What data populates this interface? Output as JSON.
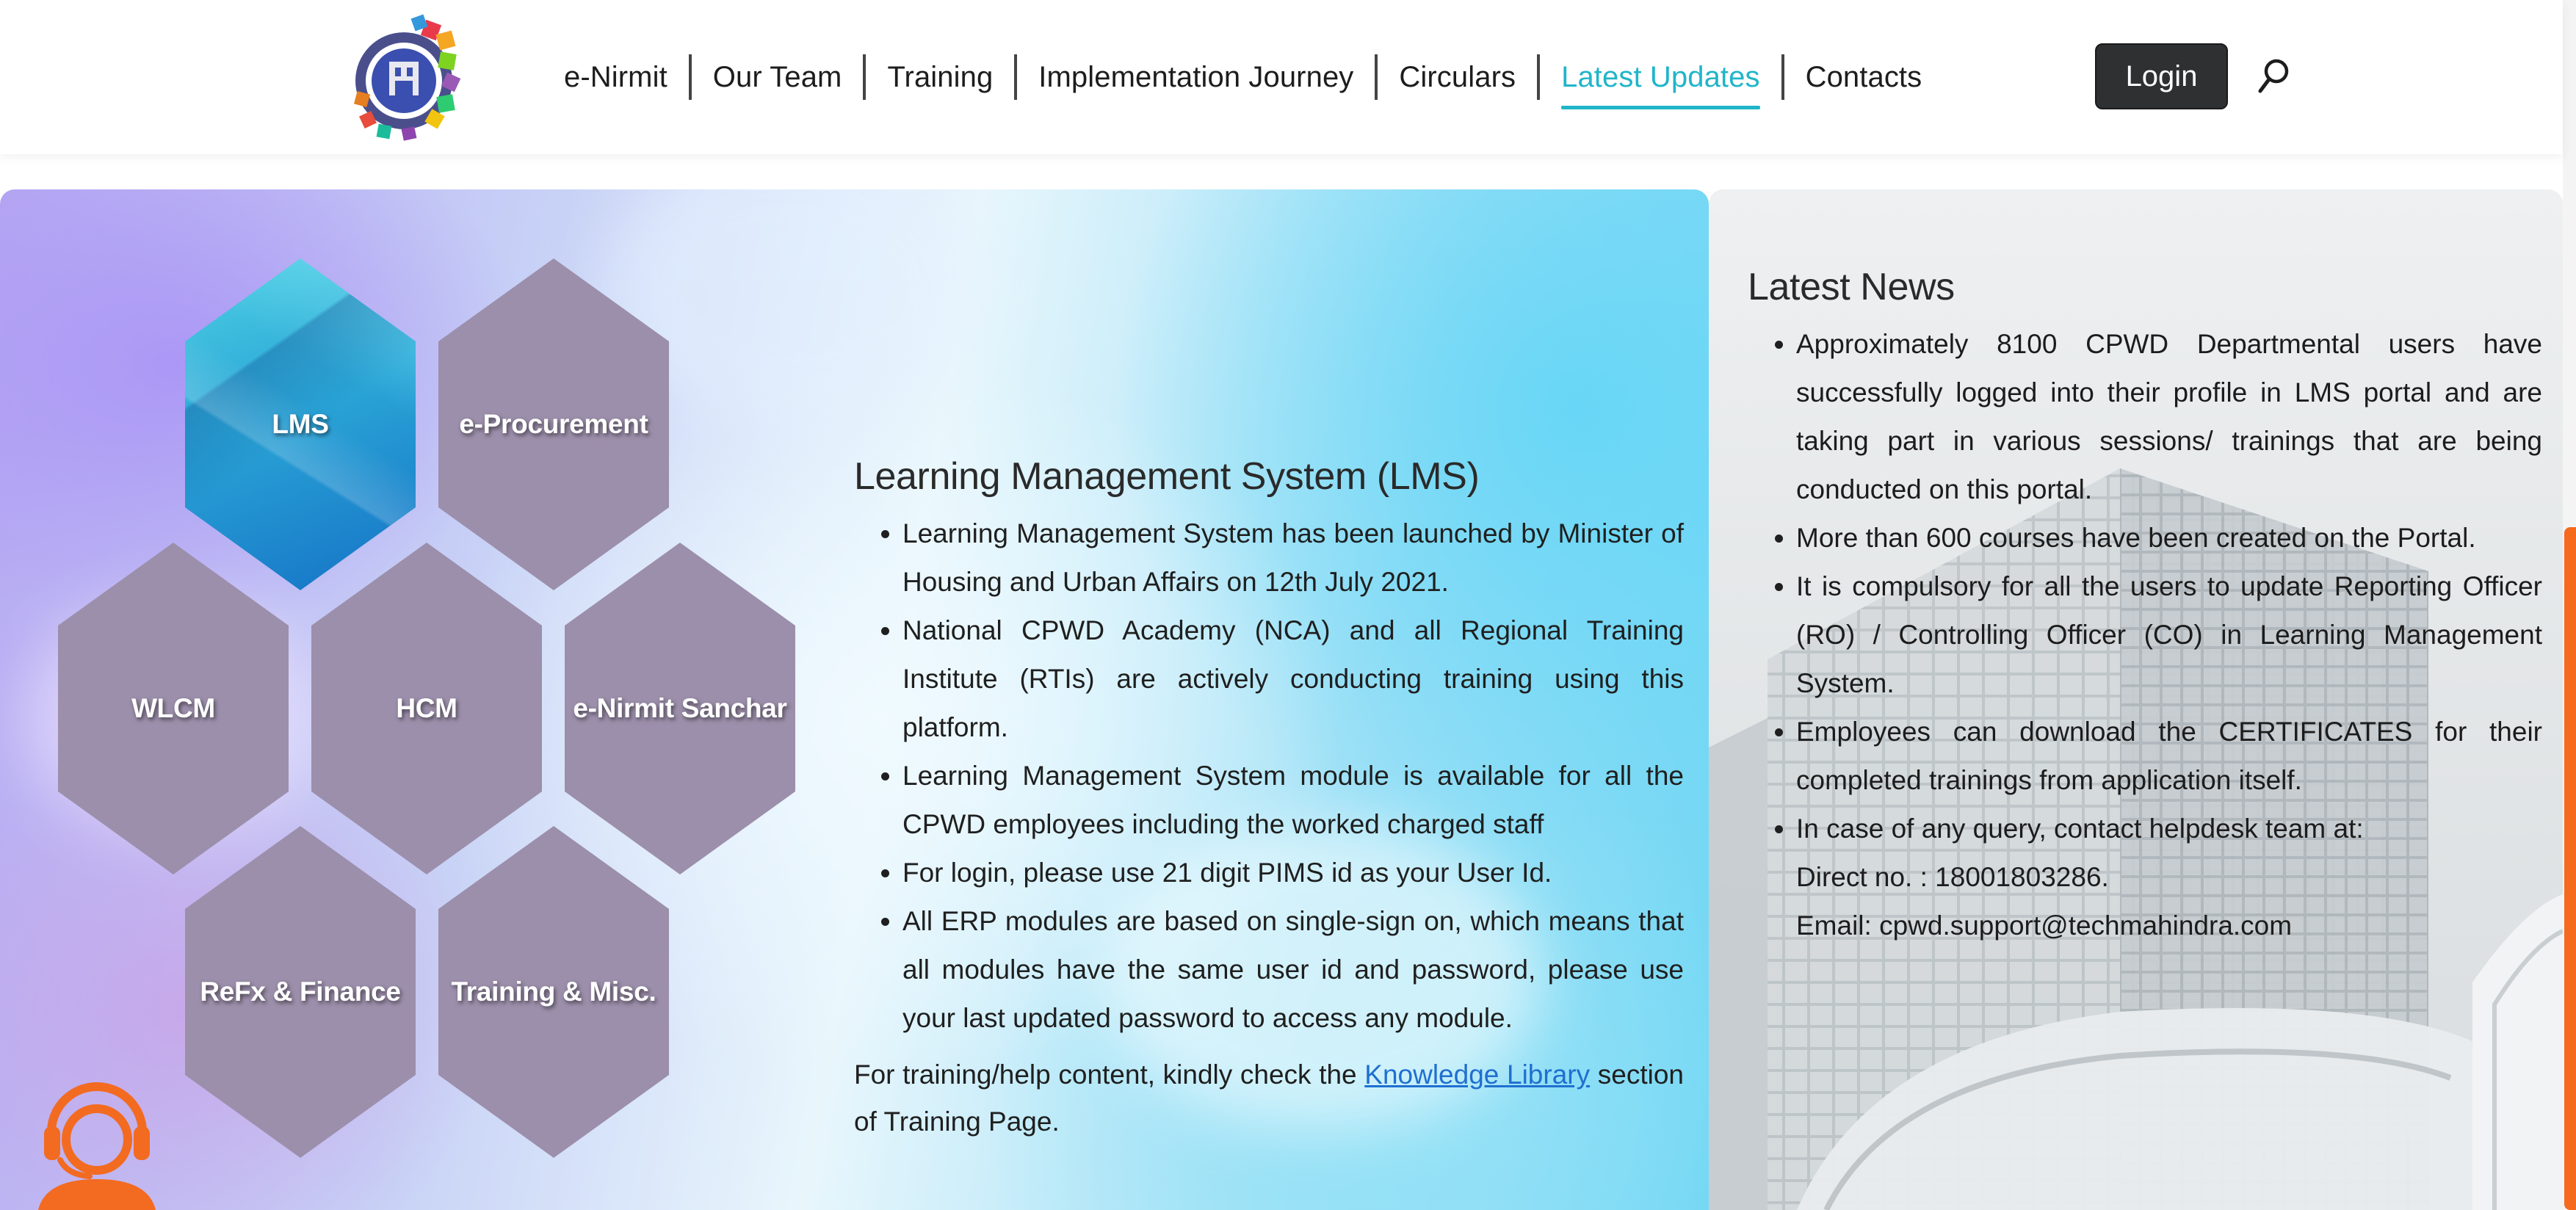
{
  "header": {
    "nav": [
      {
        "label": "e-Nirmit",
        "active": false
      },
      {
        "label": "Our Team",
        "active": false
      },
      {
        "label": "Training",
        "active": false
      },
      {
        "label": "Implementation Journey",
        "active": false
      },
      {
        "label": "Circulars",
        "active": false
      },
      {
        "label": "Latest Updates",
        "active": true
      },
      {
        "label": "Contacts",
        "active": false
      }
    ],
    "login_label": "Login",
    "accent_color": "#20b5c9"
  },
  "modules": [
    {
      "label": "LMS",
      "selected": true
    },
    {
      "label": "e-Procurement",
      "selected": false
    },
    {
      "label": "WLCM",
      "selected": false
    },
    {
      "label": "HCM",
      "selected": false
    },
    {
      "label": "e-Nirmit Sanchar",
      "selected": false
    },
    {
      "label": "ReFx & Finance",
      "selected": false
    },
    {
      "label": "Training & Misc.",
      "selected": false
    }
  ],
  "lms": {
    "title": "Learning Management System (LMS)",
    "bullets": [
      "Learning Management System has been launched by Minister of Housing and Urban Affairs on 12th July 2021.",
      "National CPWD Academy (NCA) and all Regional Training Institute (RTIs) are actively conducting training using this platform.",
      "Learning Management System module is available for all the CPWD employees including the worked charged staff",
      "For login, please use 21 digit PIMS id as your User Id.",
      "All ERP modules are based on single-sign on, which means that all modules have the same user id and password, please use your last updated password to access any module."
    ],
    "help_prefix": "For training/help content, kindly check the ",
    "help_link": "Knowledge Library",
    "help_suffix": " section of Training Page."
  },
  "news": {
    "title": "Latest News",
    "bullets": [
      "Approximately 8100 CPWD Departmental users have successfully logged into their profile in LMS portal and are taking part in various sessions/ trainings that are being conducted on this portal.",
      "More than 600 courses have been created on the Portal.",
      "It is compulsory for all the users to update Reporting Officer (RO) / Controlling Officer (CO) in Learning Management System.",
      "Employees can download the CERTIFICATES for their completed trainings from application itself.",
      "In case of any query, contact helpdesk team at:"
    ],
    "direct_no": "Direct no. : 18001803286.",
    "email": "Email: cpwd.support@techmahindra.com"
  },
  "icons": {
    "logo": "cpwd-emblem-logo",
    "search": "search-icon",
    "support": "headset-support-icon"
  }
}
